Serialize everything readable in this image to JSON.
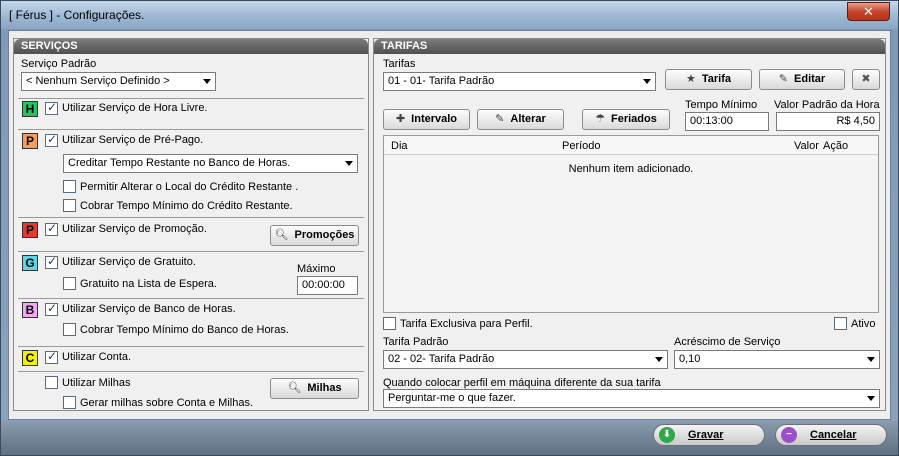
{
  "window": {
    "title": "[ Férus ] - Configurações.",
    "close_glyph": "✕"
  },
  "servicos": {
    "header": "SERVIÇOS",
    "padrao_label": "Serviço Padrão",
    "padrao_value": "< Nenhum Serviço Definido >",
    "hora_livre": {
      "badge": "H",
      "label": "Utilizar Serviço de Hora Livre.",
      "checked": true
    },
    "pre_pago": {
      "badge": "P",
      "label": "Utilizar Serviço de Pré-Pago.",
      "checked": true,
      "combo_value": "Creditar Tempo Restante no Banco de Horas.",
      "opt1": "Permitir Alterar o Local do Crédito Restante .",
      "opt2": "Cobrar Tempo Mínimo do Crédito Restante."
    },
    "promocao": {
      "badge": "P",
      "label": "Utilizar Serviço de Promoção.",
      "checked": true,
      "button": "Promoções"
    },
    "gratuito": {
      "badge": "G",
      "label": "Utilizar Serviço de Gratuito.",
      "checked": true,
      "opt1": "Gratuito na Lista de Espera.",
      "max_label": "Máximo",
      "max_value": "00:00:00"
    },
    "banco_horas": {
      "badge": "B",
      "label": "Utilizar Serviço de Banco de Horas.",
      "checked": true,
      "opt1": "Cobrar Tempo Mínimo do Banco de Horas."
    },
    "conta": {
      "badge": "C",
      "label": "Utilizar Conta.",
      "checked": true
    },
    "milhas": {
      "label": "Utilizar Milhas",
      "opt1": "Gerar milhas sobre Conta e Milhas.",
      "button": "Milhas"
    }
  },
  "tarifas": {
    "header": "TARIFAS",
    "tarifas_label": "Tarifas",
    "tarifas_value": "01 - 01- Tarifa Padrão",
    "btn_tarifa": "Tarifa",
    "btn_editar": "Editar",
    "btn_intervalo": "Intervalo",
    "btn_alterar": "Alterar",
    "btn_feriados": "Feriados",
    "tempo_minimo_label": "Tempo Mínimo",
    "tempo_minimo_value": "00:13:00",
    "valor_padrao_label": "Valor Padrão da Hora",
    "valor_padrao_value": "R$ 4,50",
    "grid": {
      "columns": [
        "Dia",
        "Período",
        "Valor",
        "Ação"
      ],
      "empty_text": "Nenhum item adicionado."
    },
    "exclusiva_perfil": "Tarifa Exclusiva para Perfil.",
    "ativo": "Ativo",
    "tarifa_padrao_label": "Tarifa Padrão",
    "tarifa_padrao_value": "02 - 02- Tarifa Padrão",
    "acrescimo_label": "Acréscimo de Serviço",
    "acrescimo_value": "0,10",
    "perfil_label": "Quando colocar perfil em máquina diferente da sua tarifa",
    "perfil_value": "Perguntar-me o que fazer."
  },
  "footer": {
    "gravar": "Gravar",
    "cancelar": "Cancelar"
  },
  "colors": {
    "badge_h": "#22c55e",
    "badge_p_orange": "#f59e5b",
    "badge_p_red": "#e53935",
    "badge_g": "#5ad6e6",
    "badge_b": "#f0a8f0",
    "badge_c": "#f2f200"
  }
}
